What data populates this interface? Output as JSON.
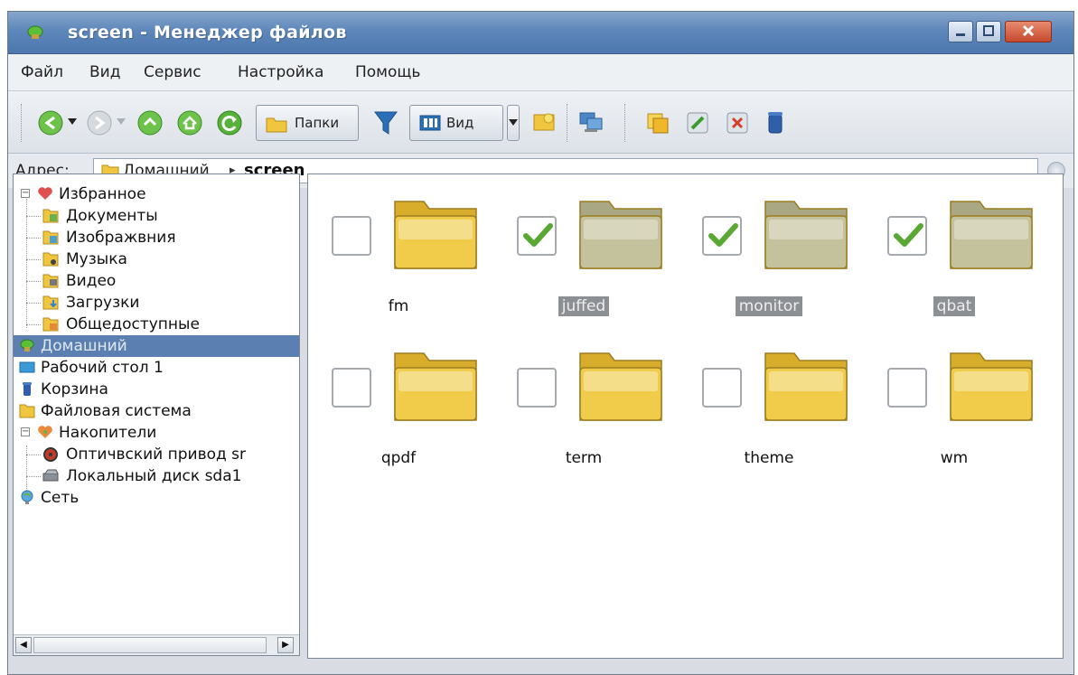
{
  "window": {
    "title": "screen - Менеджер файлов",
    "controls": {
      "minimize": "minimize",
      "maximize": "maximize",
      "close": "close"
    }
  },
  "menubar": [
    "Файл",
    "Вид",
    "Сервис",
    "Настройка",
    "Помощь"
  ],
  "toolbar": {
    "folders_label": "Папки",
    "view_label": "Вид",
    "icons": [
      "back-icon",
      "forward-icon",
      "up-icon",
      "home-icon",
      "reload-icon",
      "folders-icon",
      "filter-icon",
      "view-icon",
      "new-folder-icon",
      "network-icon",
      "copy-icon",
      "rename-icon",
      "delete-icon",
      "trash-icon"
    ]
  },
  "address": {
    "label": "Адрес:",
    "home": "Домашний",
    "current": "screen"
  },
  "sidebar": {
    "favorites": "Избранное",
    "favorites_items": [
      "Документы",
      "Изображвния",
      "Музыка",
      "Видео",
      "Загрузки",
      "Общедоступные"
    ],
    "home": "Домашний",
    "desktop": "Рабочий стол 1",
    "trash": "Корзина",
    "filesystem": "Файловая система",
    "drives": "Накопители",
    "drives_items": [
      "Оптичвский привод sr",
      "Локальный диск sda1"
    ],
    "network": "Сеть"
  },
  "files": [
    {
      "name": "fm",
      "checked": false
    },
    {
      "name": "juffed",
      "checked": true
    },
    {
      "name": "monitor",
      "checked": true
    },
    {
      "name": "qbat",
      "checked": true
    },
    {
      "name": "qpdf",
      "checked": false
    },
    {
      "name": "term",
      "checked": false
    },
    {
      "name": "theme",
      "checked": false
    },
    {
      "name": "wm",
      "checked": false
    }
  ],
  "colors": {
    "titlebar": "#5e87ba",
    "selection": "#5a7fb0",
    "folder_yellow": "#f0cc4a",
    "folder_selected": "#c4c29c",
    "check_green": "#5aa834"
  }
}
